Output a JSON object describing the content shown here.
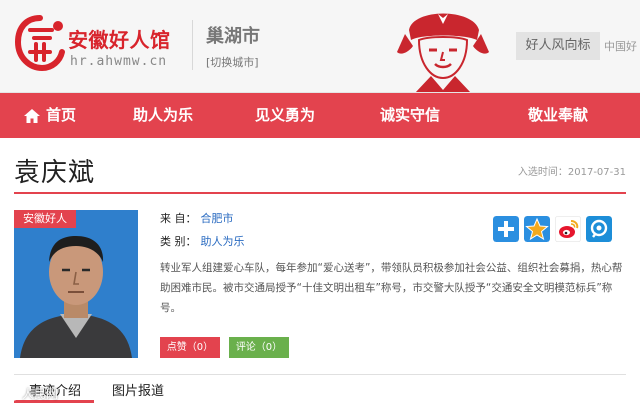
{
  "header": {
    "site_title": "安徽好人馆",
    "site_url": "hr.ahwmw.cn",
    "city": "巢湖市",
    "switch_city": "[切换城市]",
    "promo": "好人风向标",
    "promo_tail": "中国好"
  },
  "nav": {
    "home": "首页",
    "items": [
      "助人为乐",
      "见义勇为",
      "诚实守信",
      "敬业奉献"
    ]
  },
  "person": {
    "name": "袁庆斌",
    "select_time": "入选时间：2017-07-31",
    "photo_tag": "安徽好人",
    "from_label": "来  自：",
    "from_value": "合肥市",
    "category_label": "类  别：",
    "category_value": "助人为乐",
    "description": "转业军人组建爱心车队，每年参加“爱心送考”，带领队员积极参加社会公益、组织社会募捐，热心帮助困难市民。被市交通局授予“十佳文明出租车”称号，市交警大队授予“交通安全文明模范标兵”称号。",
    "like_label": "点赞（0）",
    "comment_label": "评论（0）"
  },
  "share": {
    "icons": [
      "plus-share-icon",
      "qzone-star-icon",
      "weibo-icon",
      "tencent-weibo-icon"
    ],
    "colors": [
      "#2b8fe0",
      "#f2a91e",
      "#e6162d",
      "#1d8ed8"
    ]
  },
  "tabs": {
    "story": "事迹介绍",
    "photos": "图片报道"
  },
  "watermark": "人民网",
  "colors": {
    "brand_red": "#e3434e",
    "link_blue": "#2a6bc1",
    "comment_green": "#6ab04c"
  }
}
